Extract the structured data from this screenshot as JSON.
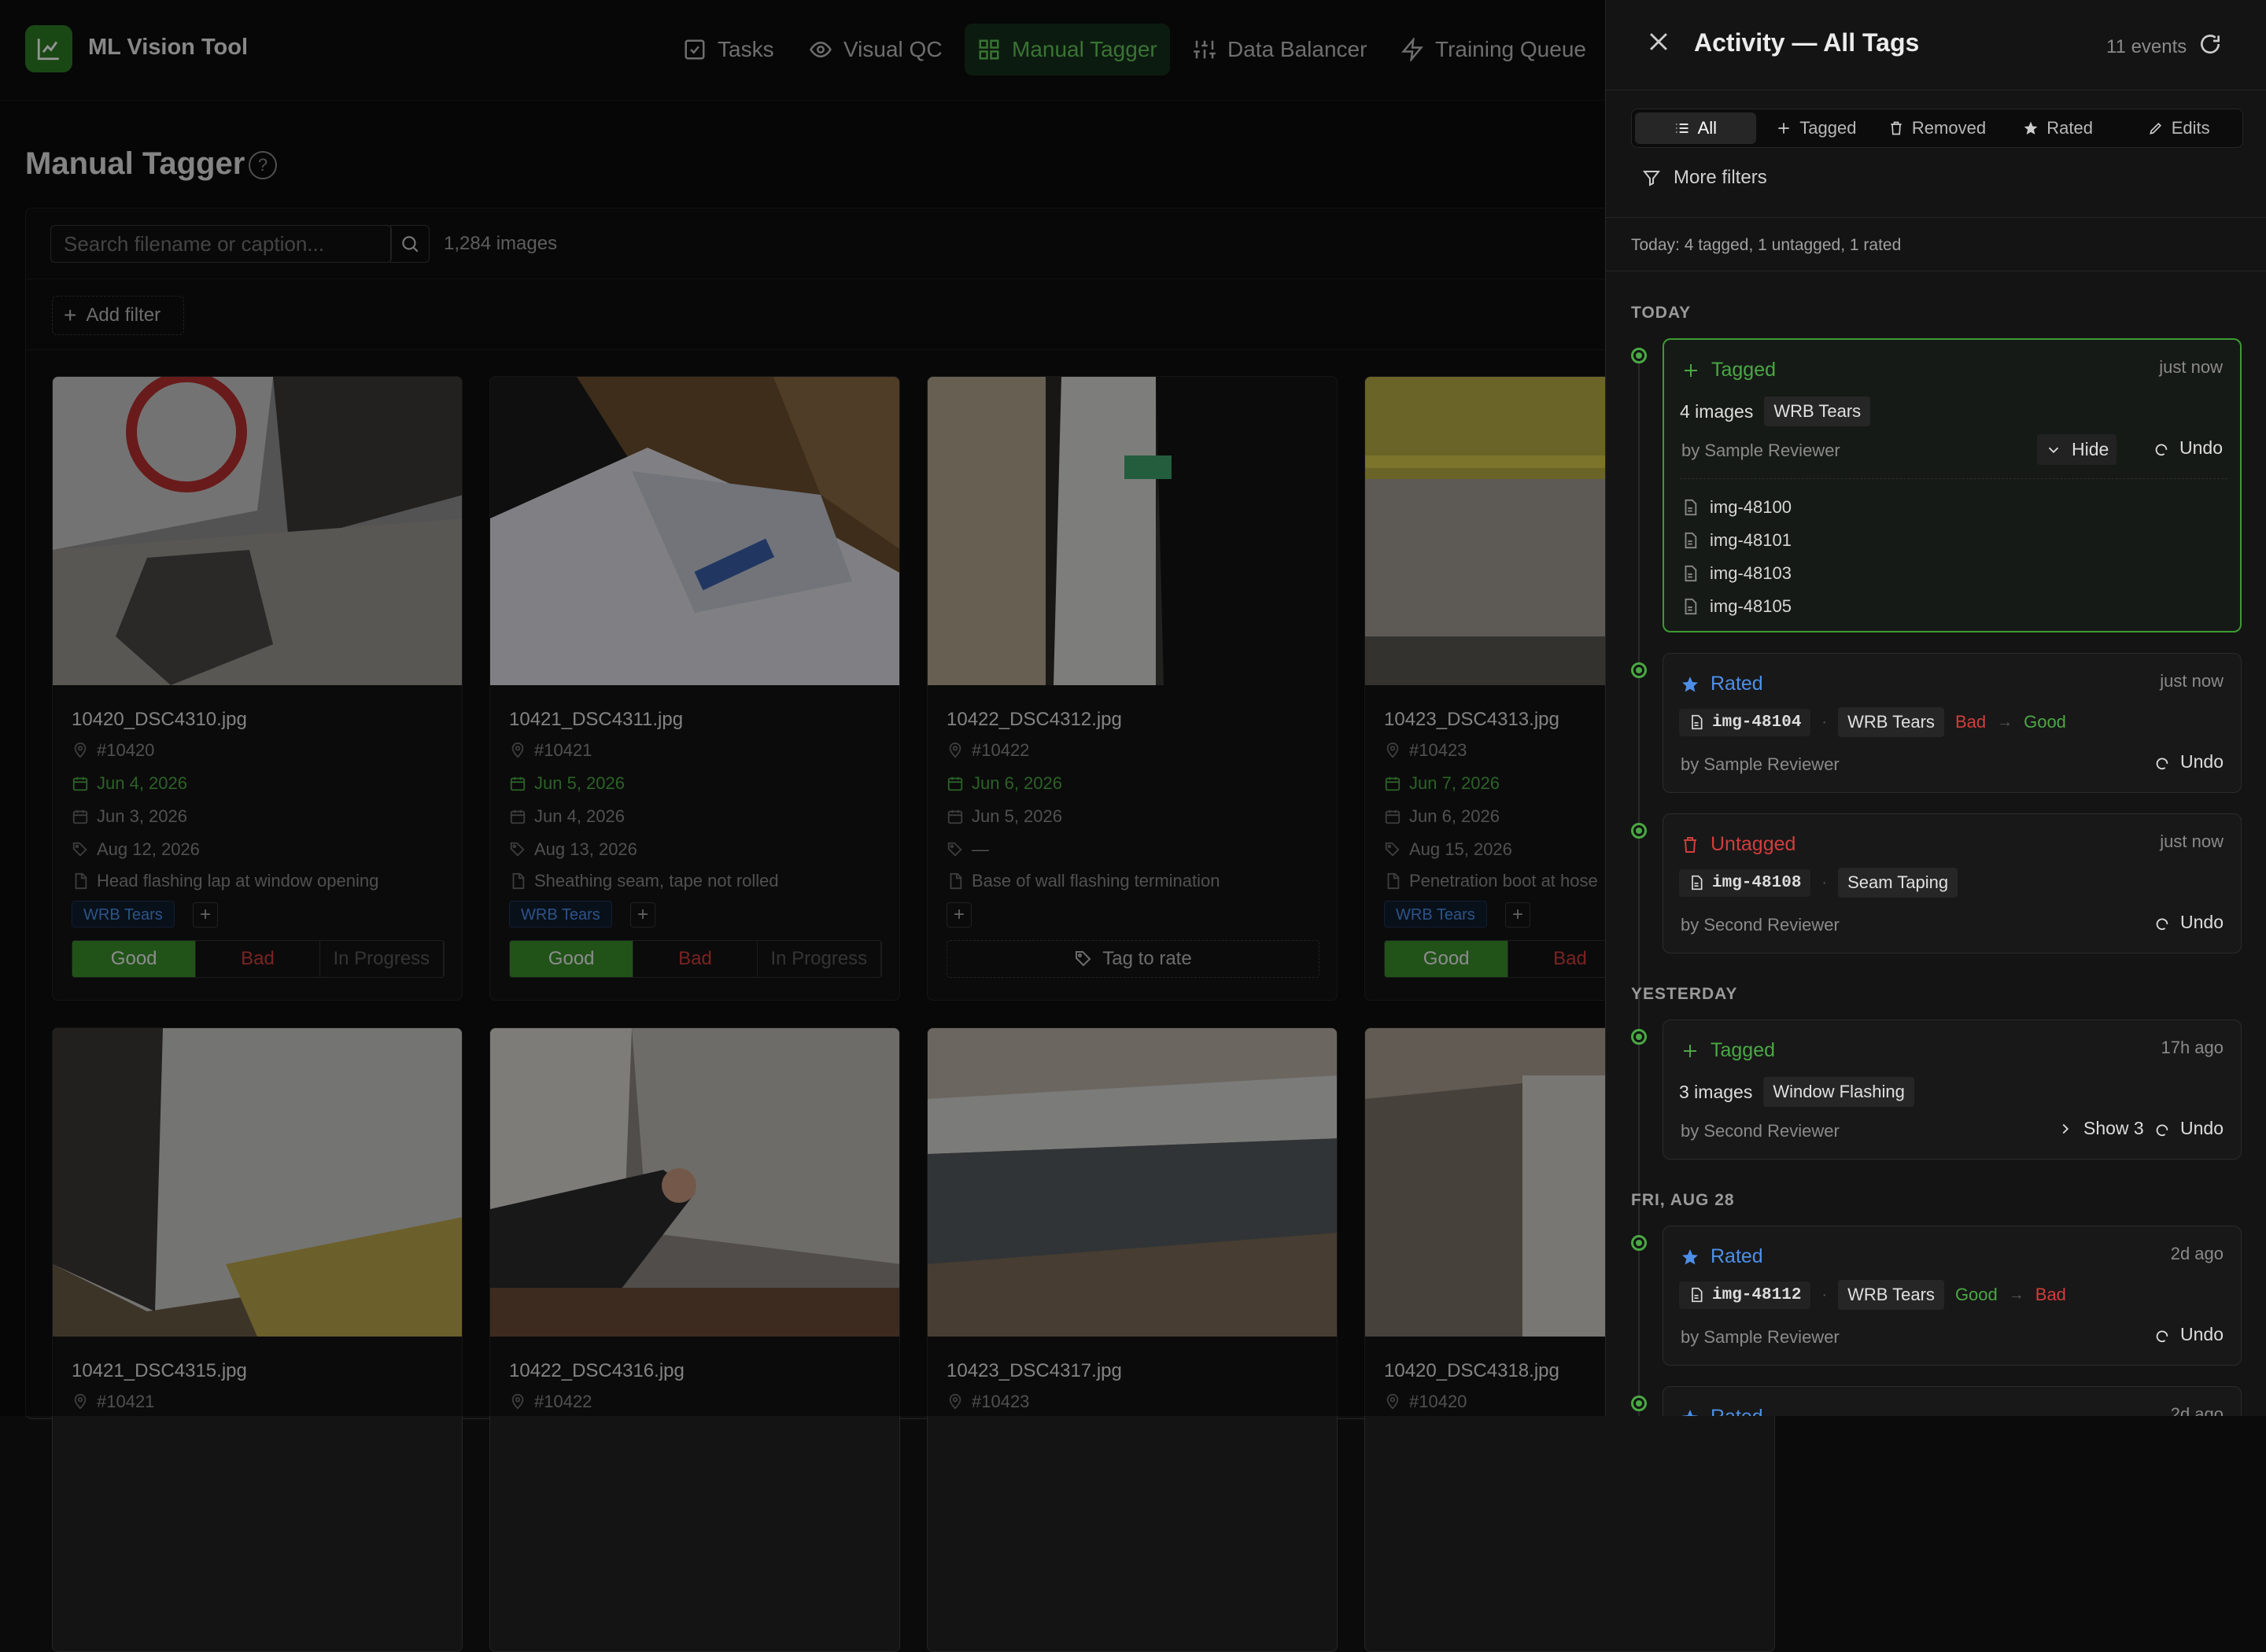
{
  "app": {
    "title": "ML Vision Tool",
    "brand_color": "#2e7d25"
  },
  "nav": {
    "items": [
      {
        "label": "Tasks",
        "icon": "checkbox-icon",
        "active": false
      },
      {
        "label": "Visual QC",
        "icon": "eye-icon",
        "active": false
      },
      {
        "label": "Manual Tagger",
        "icon": "grid-icon",
        "active": true
      },
      {
        "label": "Data Balancer",
        "icon": "sliders-icon",
        "active": false
      },
      {
        "label": "Training Queue",
        "icon": "lightning-icon",
        "active": false
      }
    ]
  },
  "main": {
    "title": "Manual Tagger",
    "search_placeholder": "Search filename or caption...",
    "image_count": "1,284 images",
    "add_filter_label": "Add filter",
    "rating_labels": {
      "good": "Good",
      "bad": "Bad",
      "in_progress": "In Progress",
      "tag_to_rate": "Tag to rate"
    },
    "cards": [
      {
        "filename": "10420_DSC4310.jpg",
        "id": "#10420",
        "date1": "Jun 4, 2026",
        "date2": "Jun 3, 2026",
        "date3": "Aug 12, 2026",
        "caption": "Head flashing lap at window opening",
        "tag": "WRB Tears",
        "rating": "Good"
      },
      {
        "filename": "10421_DSC4311.jpg",
        "id": "#10421",
        "date1": "Jun 5, 2026",
        "date2": "Jun 4, 2026",
        "date3": "Aug 13, 2026",
        "caption": "Sheathing seam, tape not rolled",
        "tag": "WRB Tears",
        "rating": "Good"
      },
      {
        "filename": "10422_DSC4312.jpg",
        "id": "#10422",
        "date1": "Jun 6, 2026",
        "date2": "Jun 5, 2026",
        "date3": "—",
        "caption": "Base of wall flashing termination",
        "tag": "",
        "rating": ""
      },
      {
        "filename": "10423_DSC4313.jpg",
        "id": "#10423",
        "date1": "Jun 7, 2026",
        "date2": "Jun 6, 2026",
        "date3": "Aug 15, 2026",
        "caption": "Penetration boot at hose",
        "tag": "WRB Tears",
        "rating": "Good"
      },
      {
        "filename": "10421_DSC4315.jpg",
        "id": "#10421"
      },
      {
        "filename": "10422_DSC4316.jpg",
        "id": "#10422"
      },
      {
        "filename": "10423_DSC4317.jpg",
        "id": "#10423"
      },
      {
        "filename": "10420_DSC4318.jpg",
        "id": "#10420"
      }
    ]
  },
  "drawer": {
    "title": "Activity — All Tags",
    "event_count": "11 events",
    "filters": [
      "All",
      "Tagged",
      "Removed",
      "Rated",
      "Edits"
    ],
    "more_filters": "More filters",
    "summary": "Today: 4 tagged, 1 untagged, 1 rated",
    "undo_label": "Undo",
    "days": [
      "TODAY",
      "YESTERDAY",
      "FRI, AUG 28"
    ],
    "events": [
      {
        "type": "Tagged",
        "time": "just now",
        "images": "4 images",
        "tag": "WRB Tears",
        "by": "by Sample Reviewer",
        "toggle": "Hide",
        "files": [
          "img-48100",
          "img-48101",
          "img-48103",
          "img-48105"
        ]
      },
      {
        "type": "Rated",
        "time": "just now",
        "file": "img-48104",
        "tag": "WRB Tears",
        "from": "Bad",
        "to": "Good",
        "by": "by Sample Reviewer"
      },
      {
        "type": "Untagged",
        "time": "just now",
        "file": "img-48108",
        "tag": "Seam Taping",
        "by": "by Second Reviewer"
      },
      {
        "type": "Tagged",
        "time": "17h ago",
        "images": "3 images",
        "tag": "Window Flashing",
        "by": "by Second Reviewer",
        "toggle": "Show 3"
      },
      {
        "type": "Rated",
        "time": "2d ago",
        "file": "img-48112",
        "tag": "WRB Tears",
        "from": "Good",
        "to": "Bad",
        "by": "by Sample Reviewer"
      },
      {
        "type": "Rated",
        "time": "2d ago"
      }
    ]
  }
}
